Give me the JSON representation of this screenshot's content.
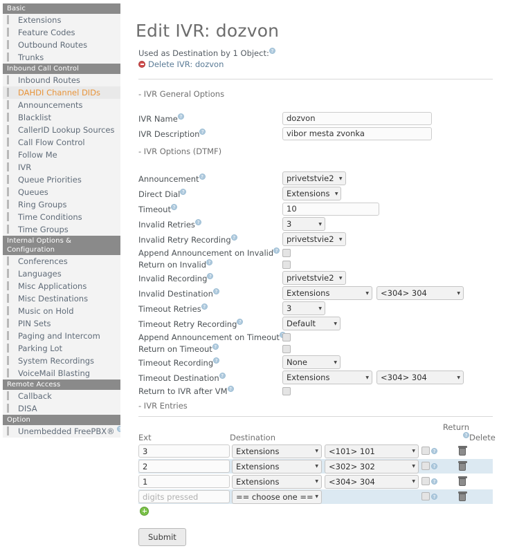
{
  "sidebar": {
    "groups": [
      {
        "title": "Basic",
        "items": [
          {
            "label": "Extensions",
            "active": false
          },
          {
            "label": "Feature Codes",
            "active": false
          },
          {
            "label": "Outbound Routes",
            "active": false
          },
          {
            "label": "Trunks",
            "active": false
          }
        ]
      },
      {
        "title": "Inbound Call Control",
        "items": [
          {
            "label": "Inbound Routes",
            "active": false
          },
          {
            "label": "DAHDI Channel DIDs",
            "active": true
          },
          {
            "label": "Announcements",
            "active": false
          },
          {
            "label": "Blacklist",
            "active": false
          },
          {
            "label": "CallerID Lookup Sources",
            "active": false
          },
          {
            "label": "Call Flow Control",
            "active": false
          },
          {
            "label": "Follow Me",
            "active": false
          },
          {
            "label": "IVR",
            "active": false
          },
          {
            "label": "Queue Priorities",
            "active": false
          },
          {
            "label": "Queues",
            "active": false
          },
          {
            "label": "Ring Groups",
            "active": false
          },
          {
            "label": "Time Conditions",
            "active": false
          },
          {
            "label": "Time Groups",
            "active": false
          }
        ]
      },
      {
        "title": "Internal Options & Configuration",
        "items": [
          {
            "label": "Conferences",
            "active": false
          },
          {
            "label": "Languages",
            "active": false
          },
          {
            "label": "Misc Applications",
            "active": false
          },
          {
            "label": "Misc Destinations",
            "active": false
          },
          {
            "label": "Music on Hold",
            "active": false
          },
          {
            "label": "PIN Sets",
            "active": false
          },
          {
            "label": "Paging and Intercom",
            "active": false
          },
          {
            "label": "Parking Lot",
            "active": false
          },
          {
            "label": "System Recordings",
            "active": false
          },
          {
            "label": "VoiceMail Blasting",
            "active": false
          }
        ]
      },
      {
        "title": "Remote Access",
        "items": [
          {
            "label": "Callback",
            "active": false
          },
          {
            "label": "DISA",
            "active": false
          }
        ]
      },
      {
        "title": "Option",
        "items": [
          {
            "label": "Unembedded FreePBX®",
            "active": false,
            "help": true
          }
        ]
      }
    ]
  },
  "header": {
    "title": "Edit IVR: dozvon",
    "used_as_destination": "Used as Destination by 1 Object:",
    "delete_link": "Delete IVR: dozvon"
  },
  "sections": {
    "general": "- IVR General Options",
    "dtmf": "- IVR Options (DTMF)",
    "entries": "- IVR Entries"
  },
  "general": {
    "name_label": "IVR Name",
    "name_value": "dozvon",
    "description_label": "IVR Description",
    "description_value": "vibor mesta zvonka"
  },
  "dtmf": {
    "announcement_label": "Announcement",
    "announcement_value": "privetstvie2",
    "direct_dial_label": "Direct Dial",
    "direct_dial_value": "Extensions",
    "timeout_label": "Timeout",
    "timeout_value": "10",
    "invalid_retries_label": "Invalid Retries",
    "invalid_retries_value": "3",
    "invalid_retry_recording_label": "Invalid Retry Recording",
    "invalid_retry_recording_value": "privetstvie2",
    "append_announcement_invalid_label": "Append Announcement on Invalid",
    "return_on_invalid_label": "Return on Invalid",
    "invalid_recording_label": "Invalid Recording",
    "invalid_recording_value": "privetstvie2",
    "invalid_destination_label": "Invalid Destination",
    "invalid_destination_type": "Extensions",
    "invalid_destination_value": "<304>  304",
    "timeout_retries_label": "Timeout Retries",
    "timeout_retries_value": "3",
    "timeout_retry_recording_label": "Timeout Retry Recording",
    "timeout_retry_recording_value": "Default",
    "append_announcement_timeout_label": "Append Announcement on Timeout",
    "return_on_timeout_label": "Return on Timeout",
    "timeout_recording_label": "Timeout Recording",
    "timeout_recording_value": "None",
    "timeout_destination_label": "Timeout Destination",
    "timeout_destination_type": "Extensions",
    "timeout_destination_value": "<304>  304",
    "return_to_ivr_after_vm_label": "Return to IVR after VM"
  },
  "entries": {
    "columns": {
      "ext": "Ext",
      "destination": "Destination",
      "return": "Return",
      "delete": "Delete"
    },
    "rows": [
      {
        "ext": "3",
        "ext_placeholder": "",
        "dest_type": "Extensions",
        "dest_value": "<101>  101"
      },
      {
        "ext": "2",
        "ext_placeholder": "",
        "dest_type": "Extensions",
        "dest_value": "<302>  302"
      },
      {
        "ext": "1",
        "ext_placeholder": "",
        "dest_type": "Extensions",
        "dest_value": "<304>  304"
      },
      {
        "ext": "",
        "ext_placeholder": "digits pressed",
        "dest_type": "== choose one ==",
        "dest_value": ""
      }
    ]
  },
  "submit_label": "Submit",
  "colors": {
    "nav_section_bg": "#8a8a8a",
    "nav_item_bg": "#f3f3f3",
    "nav_active_text": "#e8943a",
    "row_alt_bg": "#dce9f2",
    "help_badge": "#aec9dd",
    "delete_red": "#d14d4d",
    "add_green": "#7cc24a"
  }
}
